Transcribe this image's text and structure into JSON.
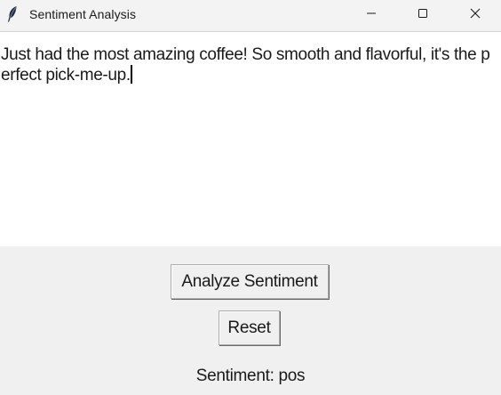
{
  "window": {
    "title": "Sentiment Analysis",
    "icon": "feather-icon",
    "controls": [
      "minimize-icon",
      "maximize-icon",
      "close-icon"
    ]
  },
  "editor": {
    "text": "Just had the most amazing coffee! So smooth and flavorful, it's the perfect pick-me-up."
  },
  "buttons": {
    "analyze_label": "Analyze Sentiment",
    "reset_label": "Reset"
  },
  "result": {
    "text": "Sentiment: pos"
  }
}
